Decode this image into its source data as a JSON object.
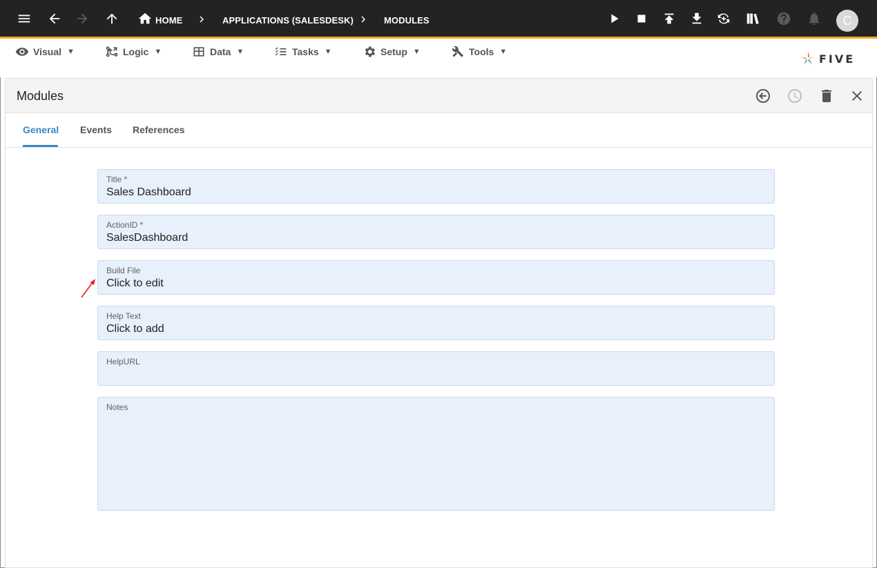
{
  "topbar": {
    "breadcrumbs": {
      "home": "HOME",
      "application": "APPLICATIONS (SALESDESK)",
      "modules": "MODULES"
    },
    "avatar_initial": "C"
  },
  "menubar": {
    "items": [
      {
        "label": "Visual",
        "icon": "eye-icon"
      },
      {
        "label": "Logic",
        "icon": "logic-icon"
      },
      {
        "label": "Data",
        "icon": "table-icon"
      },
      {
        "label": "Tasks",
        "icon": "tasks-icon"
      },
      {
        "label": "Setup",
        "icon": "gear-icon"
      },
      {
        "label": "Tools",
        "icon": "tools-icon"
      }
    ],
    "caret": "▼",
    "logo_text": "FIVE"
  },
  "panel": {
    "title": "Modules",
    "tabs": [
      "General",
      "Events",
      "References"
    ],
    "active_tab": "General"
  },
  "form": {
    "title": {
      "label": "Title *",
      "value": "Sales Dashboard"
    },
    "action_id": {
      "label": "ActionID *",
      "value": "SalesDashboard"
    },
    "build_file": {
      "label": "Build File",
      "value": "Click to edit"
    },
    "help_text": {
      "label": "Help Text",
      "value": "Click to add"
    },
    "help_url": {
      "label": "HelpURL",
      "value": ""
    },
    "notes": {
      "label": "Notes",
      "value": ""
    }
  },
  "colors": {
    "topbar_bg": "#232323",
    "accent_orange": "#f5a623",
    "tab_active": "#3a87c9",
    "field_bg": "#e7f0fb",
    "annotation_arrow": "#e02020"
  }
}
